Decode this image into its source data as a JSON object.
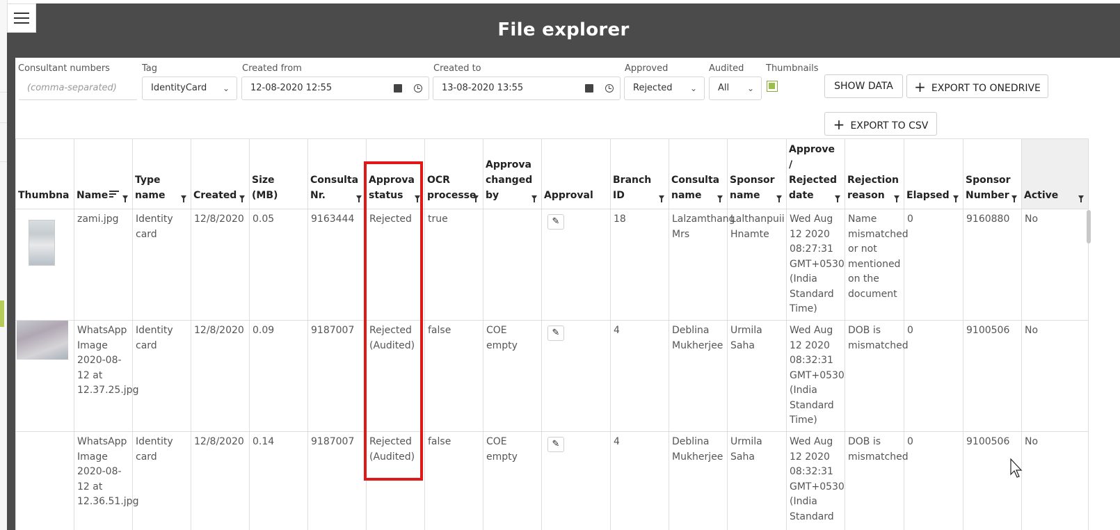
{
  "header": {
    "title": "File explorer"
  },
  "filters": {
    "consultant_numbers": {
      "label": "Consultant numbers",
      "placeholder": "(comma-separated)"
    },
    "tag": {
      "label": "Tag",
      "value": "IdentityCard"
    },
    "created_from": {
      "label": "Created from",
      "value": "12-08-2020 12:55"
    },
    "created_to": {
      "label": "Created to",
      "value": "13-08-2020 13:55"
    },
    "approved": {
      "label": "Approved",
      "value": "Rejected"
    },
    "audited": {
      "label": "Audited",
      "value": "All"
    },
    "thumbnails": {
      "label": "Thumbnails",
      "checked": true
    }
  },
  "buttons": {
    "show_data": "SHOW DATA",
    "export_onedrive": "EXPORT TO ONEDRIVE",
    "export_csv": "EXPORT TO CSV"
  },
  "table": {
    "columns": [
      {
        "line1": "",
        "line2": "Thumbna"
      },
      {
        "line1": "",
        "line2": "Name"
      },
      {
        "line1": "Type",
        "line2": "name"
      },
      {
        "line1": "",
        "line2": "Created"
      },
      {
        "line1": "Size",
        "line2": "(MB)"
      },
      {
        "line1": "Consulta",
        "line2": "Nr."
      },
      {
        "line1": "Approva",
        "line2": "status"
      },
      {
        "line1": "OCR",
        "line2": "processe"
      },
      {
        "line0": "Approva",
        "line1": "changed",
        "line2": "by"
      },
      {
        "line1": "",
        "line2": "Approval"
      },
      {
        "line1": "Branch",
        "line2": "ID"
      },
      {
        "line1": "Consulta",
        "line2": "name"
      },
      {
        "line1": "Sponsor",
        "line2": "name"
      },
      {
        "line_a": "Approve",
        "line0": "/",
        "line_b": "Rejected",
        "line2": "date"
      },
      {
        "line1": "Rejection",
        "line2": "reason"
      },
      {
        "line1": "",
        "line2": "Elapsed"
      },
      {
        "line1": "Sponsor",
        "line2": "Number"
      },
      {
        "line1": "",
        "line2": "Active"
      }
    ],
    "rows": [
      {
        "name": [
          "zami.jpg"
        ],
        "type": [
          "Identity",
          "card"
        ],
        "created": "12/8/2020",
        "size": "0.05",
        "consultant_nr": "9163444",
        "status": [
          "Rejected"
        ],
        "ocr": "true",
        "changed_by": "",
        "branch": "18",
        "consultant_name": [
          "Lalzamthang",
          "Mrs"
        ],
        "sponsor_name": [
          "Lalthanpuii",
          "Hnamte"
        ],
        "date": [
          "Wed Aug",
          "12 2020",
          "08:27:31",
          "GMT+0530",
          "(India",
          "Standard",
          "Time)"
        ],
        "reason": [
          "Name",
          "mismatched",
          "or not",
          "mentioned",
          "on the",
          "document"
        ],
        "elapsed": "0",
        "sponsor_number": "9160880",
        "active": "No"
      },
      {
        "name": [
          "WhatsApp",
          "Image",
          "2020-08-",
          "12 at",
          "12.37.25.jpg"
        ],
        "type": [
          "Identity",
          "card"
        ],
        "created": "12/8/2020",
        "size": "0.09",
        "consultant_nr": "9187007",
        "status": [
          "Rejected",
          "(Audited)"
        ],
        "ocr": "false",
        "changed_by": "COE empty",
        "branch": "4",
        "consultant_name": [
          "Deblina",
          "Mukherjee"
        ],
        "sponsor_name": [
          "Urmila",
          "Saha"
        ],
        "date": [
          "Wed Aug",
          "12 2020",
          "08:32:31",
          "GMT+0530",
          "(India",
          "Standard",
          "Time)"
        ],
        "reason": [
          "DOB is",
          "mismatched"
        ],
        "elapsed": "0",
        "sponsor_number": "9100506",
        "active": "No"
      },
      {
        "name": [
          "WhatsApp",
          "Image",
          "2020-08-",
          "12 at",
          "12.36.51.jpg"
        ],
        "type": [
          "Identity",
          "card"
        ],
        "created": "12/8/2020",
        "size": "0.14",
        "consultant_nr": "9187007",
        "status": [
          "Rejected",
          "(Audited)"
        ],
        "ocr": "false",
        "changed_by": "COE empty",
        "branch": "4",
        "consultant_name": [
          "Deblina",
          "Mukherjee"
        ],
        "sponsor_name": [
          "Urmila",
          "Saha"
        ],
        "date": [
          "Wed Aug",
          "12 2020",
          "08:32:31",
          "GMT+0530",
          "(India",
          "Standard"
        ],
        "reason": [
          "DOB is",
          "mismatched"
        ],
        "elapsed": "0",
        "sponsor_number": "9100506",
        "active": "No"
      }
    ]
  },
  "icons": {
    "menu": "hamburger-menu-icon",
    "calendar": "calendar-icon",
    "clock": "clock-icon",
    "filter": "filter-icon",
    "sort": "sort-icon",
    "edit": "pencil-icon"
  },
  "colors": {
    "header_bg": "#4b4b4b",
    "highlight_box": "#e01818",
    "checkbox": "#9bbd4b"
  }
}
